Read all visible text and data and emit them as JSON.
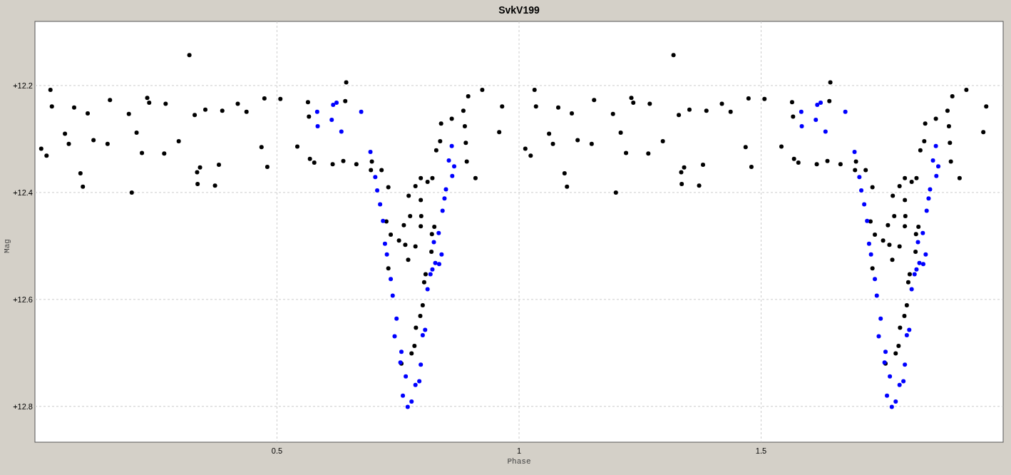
{
  "chart_data": {
    "type": "scatter",
    "title": "SvkV199",
    "xlabel": "Phase",
    "ylabel": "Mag",
    "grid": true,
    "xlim": [
      0,
      2
    ],
    "ylim": [
      12.867,
      12.08
    ],
    "xticks": [
      0.5,
      1.0,
      1.5
    ],
    "yticks": [
      {
        "value": 12.2,
        "label": "+12.2"
      },
      {
        "value": 12.4,
        "label": "+12.4"
      },
      {
        "value": 12.6,
        "label": "+12.6"
      },
      {
        "value": 12.8,
        "label": "+12.8"
      }
    ],
    "series": [
      {
        "color": "#000000",
        "x": [
          0.319,
          0.643,
          0.032,
          0.035,
          0.024,
          0.094,
          0.099,
          0.2,
          0.155,
          0.232,
          0.236,
          0.27,
          0.33,
          0.336,
          0.372,
          0.48,
          0.474,
          0.507,
          0.564,
          0.542,
          0.419,
          0.387,
          0.352,
          0.437,
          0.468,
          0.38,
          0.335,
          0.07,
          0.221,
          0.267,
          0.21,
          0.109,
          0.081,
          0.73,
          0.772,
          0.797,
          0.786,
          0.797,
          0.821,
          0.811,
          0.839,
          0.837,
          0.861,
          0.829,
          0.775,
          0.798,
          0.762,
          0.797,
          0.752,
          0.765,
          0.786,
          0.771,
          0.825,
          0.82,
          0.819,
          0.807,
          0.804,
          0.73,
          0.796,
          0.801,
          0.787,
          0.784,
          0.778,
          0.757,
          0.735,
          0.726,
          0.716,
          0.696,
          0.694,
          0.566,
          0.568,
          0.577,
          0.615,
          0.637,
          0.664,
          0.895,
          0.885,
          0.892,
          0.89,
          0.641,
          0.924,
          0.965,
          0.888,
          0.959,
          0.062,
          0.121,
          0.15,
          0.91,
          0.013,
          0.341,
          0.194,
          0.297,
          1.319,
          1.643,
          1.032,
          1.035,
          1.024,
          1.094,
          1.099,
          1.2,
          1.155,
          1.232,
          1.236,
          1.27,
          1.33,
          1.336,
          1.372,
          1.48,
          1.474,
          1.507,
          1.564,
          1.542,
          1.419,
          1.387,
          1.352,
          1.437,
          1.468,
          1.38,
          1.335,
          1.07,
          1.221,
          1.267,
          1.21,
          1.109,
          1.081,
          1.73,
          1.772,
          1.797,
          1.786,
          1.797,
          1.821,
          1.811,
          1.839,
          1.837,
          1.861,
          1.829,
          1.775,
          1.798,
          1.762,
          1.797,
          1.752,
          1.765,
          1.786,
          1.771,
          1.825,
          1.82,
          1.819,
          1.807,
          1.804,
          1.73,
          1.796,
          1.801,
          1.787,
          1.784,
          1.778,
          1.757,
          1.735,
          1.726,
          1.716,
          1.696,
          1.694,
          1.566,
          1.568,
          1.577,
          1.615,
          1.637,
          1.664,
          1.895,
          1.885,
          1.892,
          1.89,
          1.641,
          1.924,
          1.965,
          1.888,
          1.959,
          1.062,
          1.121,
          1.15,
          1.91,
          1.013,
          1.341,
          1.194,
          1.297
        ],
        "values": [
          12.143,
          12.194,
          12.208,
          12.239,
          12.331,
          12.364,
          12.389,
          12.4,
          12.227,
          12.223,
          12.232,
          12.234,
          12.255,
          12.384,
          12.387,
          12.352,
          12.224,
          12.225,
          12.231,
          12.314,
          12.234,
          12.247,
          12.245,
          12.249,
          12.315,
          12.348,
          12.362,
          12.309,
          12.326,
          12.327,
          12.288,
          12.252,
          12.241,
          12.39,
          12.406,
          12.414,
          12.388,
          12.373,
          12.373,
          12.38,
          12.271,
          12.304,
          12.262,
          12.321,
          12.444,
          12.444,
          12.461,
          12.463,
          12.49,
          12.498,
          12.501,
          12.526,
          12.464,
          12.478,
          12.511,
          12.553,
          12.568,
          12.542,
          12.631,
          12.611,
          12.653,
          12.687,
          12.701,
          12.72,
          12.479,
          12.454,
          12.358,
          12.342,
          12.358,
          12.258,
          12.337,
          12.344,
          12.347,
          12.341,
          12.347,
          12.22,
          12.247,
          12.342,
          12.307,
          12.229,
          12.208,
          12.239,
          12.276,
          12.287,
          12.29,
          12.302,
          12.309,
          12.373,
          12.318,
          12.353,
          12.253,
          12.304,
          12.143,
          12.194,
          12.208,
          12.239,
          12.331,
          12.364,
          12.389,
          12.4,
          12.227,
          12.223,
          12.232,
          12.234,
          12.255,
          12.384,
          12.387,
          12.352,
          12.224,
          12.225,
          12.231,
          12.314,
          12.234,
          12.247,
          12.245,
          12.249,
          12.315,
          12.348,
          12.362,
          12.309,
          12.326,
          12.327,
          12.288,
          12.252,
          12.241,
          12.39,
          12.406,
          12.414,
          12.388,
          12.373,
          12.373,
          12.38,
          12.271,
          12.304,
          12.262,
          12.321,
          12.444,
          12.444,
          12.461,
          12.463,
          12.49,
          12.498,
          12.501,
          12.526,
          12.464,
          12.478,
          12.511,
          12.553,
          12.568,
          12.542,
          12.631,
          12.611,
          12.653,
          12.687,
          12.701,
          12.72,
          12.479,
          12.454,
          12.358,
          12.342,
          12.358,
          12.258,
          12.337,
          12.344,
          12.347,
          12.341,
          12.347,
          12.22,
          12.247,
          12.342,
          12.307,
          12.229,
          12.208,
          12.239,
          12.276,
          12.287,
          12.29,
          12.302,
          12.309,
          12.373,
          12.318,
          12.353,
          12.253,
          12.304
        ]
      },
      {
        "color": "#0000ff",
        "x": [
          0.623,
          0.583,
          0.613,
          0.674,
          0.693,
          0.703,
          0.707,
          0.713,
          0.719,
          0.723,
          0.727,
          0.735,
          0.739,
          0.747,
          0.743,
          0.757,
          0.755,
          0.766,
          0.76,
          0.77,
          0.778,
          0.786,
          0.794,
          0.797,
          0.801,
          0.806,
          0.811,
          0.817,
          0.821,
          0.827,
          0.835,
          0.84,
          0.834,
          0.824,
          0.842,
          0.846,
          0.849,
          0.862,
          0.855,
          0.866,
          0.861,
          0.584,
          0.633,
          0.616,
          1.623,
          1.583,
          1.613,
          1.674,
          1.693,
          1.703,
          1.707,
          1.713,
          1.719,
          1.723,
          1.727,
          1.735,
          1.739,
          1.747,
          1.743,
          1.757,
          1.755,
          1.766,
          1.76,
          1.77,
          1.778,
          1.786,
          1.794,
          1.797,
          1.801,
          1.806,
          1.811,
          1.817,
          1.821,
          1.827,
          1.835,
          1.84,
          1.834,
          1.824,
          1.842,
          1.846,
          1.849,
          1.862,
          1.855,
          1.866,
          1.861,
          1.584,
          1.633,
          1.616
        ],
        "values": [
          12.232,
          12.249,
          12.264,
          12.249,
          12.324,
          12.371,
          12.396,
          12.422,
          12.453,
          12.496,
          12.516,
          12.562,
          12.593,
          12.636,
          12.669,
          12.698,
          12.718,
          12.744,
          12.78,
          12.801,
          12.791,
          12.76,
          12.753,
          12.722,
          12.667,
          12.657,
          12.581,
          12.553,
          12.544,
          12.532,
          12.534,
          12.516,
          12.476,
          12.493,
          12.434,
          12.411,
          12.394,
          12.369,
          12.34,
          12.351,
          12.313,
          12.276,
          12.286,
          12.236,
          12.232,
          12.249,
          12.264,
          12.249,
          12.324,
          12.371,
          12.396,
          12.422,
          12.453,
          12.496,
          12.516,
          12.562,
          12.593,
          12.636,
          12.669,
          12.698,
          12.718,
          12.744,
          12.78,
          12.801,
          12.791,
          12.76,
          12.753,
          12.722,
          12.667,
          12.657,
          12.581,
          12.553,
          12.544,
          12.532,
          12.534,
          12.516,
          12.476,
          12.493,
          12.434,
          12.411,
          12.394,
          12.369,
          12.34,
          12.351,
          12.313,
          12.276,
          12.286,
          12.236
        ]
      }
    ]
  }
}
